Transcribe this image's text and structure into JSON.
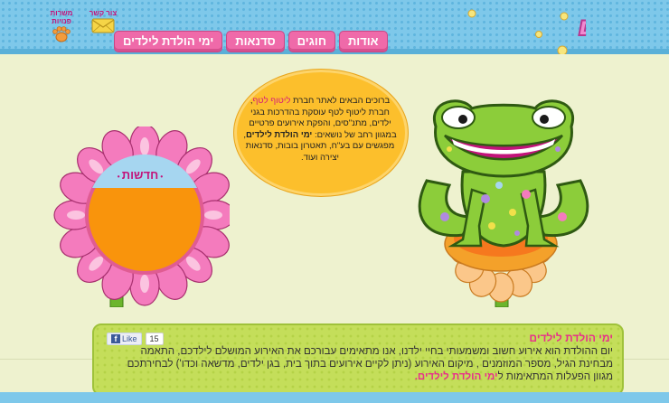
{
  "header": {
    "logo_text": "ליטוף לטף",
    "nav": [
      "אודות",
      "חוגים",
      "סדנאות",
      "ימי הולדת לילדים"
    ],
    "util": [
      {
        "label": "צור קשר",
        "icon": "envelope-icon"
      },
      {
        "label": "משרות פנויות",
        "icon": "paw-icon"
      }
    ]
  },
  "bubble": {
    "intro": "ברוכים הבאים לאתר חברת",
    "brand": "ליטוף לטף",
    "body1": ", חברת ליטוף לטף עוסקת בהדרכות בגני ילדים, מתנ\"סים, והפקת אירועים פרטיים במגוון רחב של נושאים:",
    "bold": "ימי הולדת לילדים",
    "body2": ", מפגשים עם בע\"ח, תאטרון בובות, סדנאות יצירה ועוד."
  },
  "news": {
    "title": "חדשות"
  },
  "info": {
    "title": "ימי הולדת לילדים",
    "text": "יום ההולדת הוא אירוע חשוב ומשמעותי בחיי ילדנו, אנו מתאימים עבורכם את האירוע המושלם לילדכם, התאמה מבחינת הגיל, מספר המוזמנים , מיקום האירוע (ניתן לקיים אירועים בתוך בית, בגן ילדים, מדשאה וכדו') לבחירתכם מגוון הפעלות המתאימות ל",
    "link": "ימי הולדת לילדים.",
    "fb_like": "Like",
    "fb_count": "15"
  },
  "colors": {
    "sky": "#7ec8ea",
    "nav_pink": "#ef6aa9",
    "bubble": "#fcbf2c",
    "box_green": "#c4de5a",
    "accent_pink": "#e8308a"
  }
}
